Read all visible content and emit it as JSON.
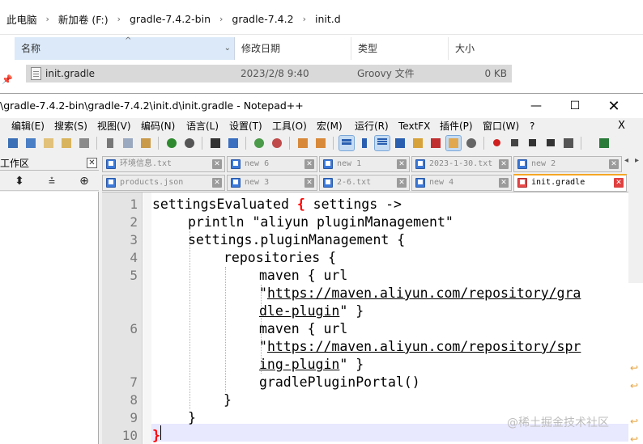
{
  "explorer": {
    "breadcrumb": [
      "此电脑",
      "新加卷 (F:)",
      "gradle-7.4.2-bin",
      "gradle-7.4.2",
      "init.d"
    ],
    "columns": {
      "name": "名称",
      "date": "修改日期",
      "type": "类型",
      "size": "大小"
    },
    "file": {
      "name": "init.gradle",
      "date": "2023/2/8 9:40",
      "type": "Groovy 文件",
      "size": "0 KB"
    }
  },
  "notepad": {
    "title": "\\gradle-7.4.2-bin\\gradle-7.4.2\\init.d\\init.gradle - Notepad++",
    "window_buttons": {
      "minimize": "—",
      "maximize": "☐",
      "close": "✕"
    },
    "menu": [
      "编辑(E)",
      "搜索(S)",
      "视图(V)",
      "编码(N)",
      "语言(L)",
      "设置(T)",
      "工具(O)",
      "宏(M)",
      "运行(R)",
      "TextFX",
      "插件(P)",
      "窗口(W)",
      "?"
    ],
    "menu_close": "X",
    "panel": {
      "title": "工作区",
      "close": "✕"
    },
    "tabs_row1": [
      {
        "label": "环境信息.txt"
      },
      {
        "label": "new 6"
      },
      {
        "label": "new 1"
      },
      {
        "label": "2023-1-30.txt"
      },
      {
        "label": "new 2"
      }
    ],
    "tabs_row2": [
      {
        "label": "products.json"
      },
      {
        "label": "new 3"
      },
      {
        "label": "2-6.txt"
      },
      {
        "label": "new 4"
      },
      {
        "label": "init.gradle",
        "active": true
      }
    ],
    "tab_close": "✕",
    "line_numbers": [
      "1",
      "2",
      "3",
      "4",
      "5",
      "",
      "6",
      "",
      "7",
      "8",
      "9",
      "10"
    ],
    "code": {
      "l1a": "settingsEvaluated ",
      "l1b": "{",
      "l1c": " settings ->",
      "l2": "println \"aliyun pluginManagement\"",
      "l3": "settings.pluginManagement {",
      "l4": "repositories {",
      "l5": "maven { url",
      "l5b_q": "\"",
      "l5b_url": "https://maven.aliyun.com/repository/gra",
      "l5c_url": "dle-plugin",
      "l5c_rest": "\" }",
      "l6": "maven { url",
      "l6b_q": "\"",
      "l6b_url": "https://maven.aliyun.com/repository/spr",
      "l6c_url": "ing-plugin",
      "l6c_rest": "\" }",
      "l7": "gradlePluginPortal()",
      "l8": "}",
      "l9": "}",
      "l10": "}"
    }
  },
  "watermark": "@稀土掘金技术社区",
  "colors": {
    "accent_tab": "#f5a623",
    "brace": "#ff0000",
    "current_line": "#e8e8ff"
  }
}
